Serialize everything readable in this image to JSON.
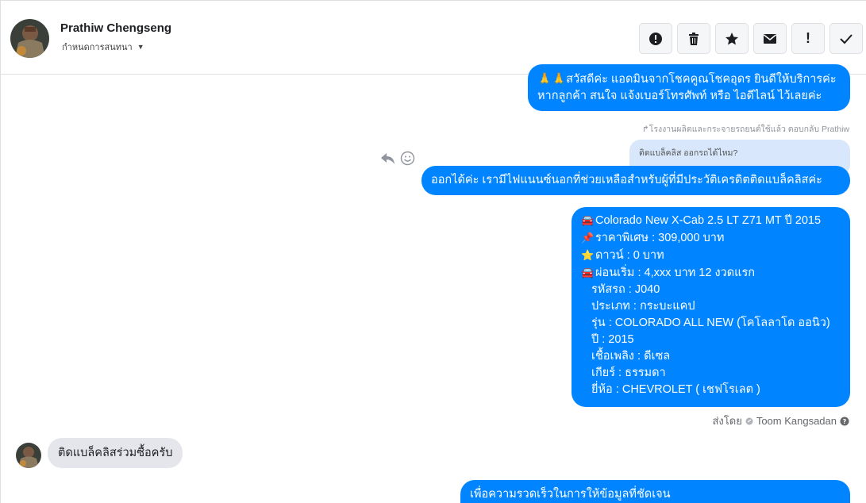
{
  "header": {
    "contact_name": "Prathiw Chengseng",
    "label_dropdown": "กำหนดการสนทนา",
    "toolbar": [
      {
        "icon": "alert-circle-icon"
      },
      {
        "icon": "trash-icon"
      },
      {
        "icon": "star-icon"
      },
      {
        "icon": "envelope-icon"
      },
      {
        "icon": "exclamation-icon",
        "text": "!"
      },
      {
        "icon": "check-icon"
      }
    ]
  },
  "messages": {
    "m1": {
      "line1": "🙏🙏สวัสดีค่ะ แอดมินจากโชคคูณโชคอุดร ยินดีให้บริการค่ะ",
      "line2": "หากลูกค้า สนใจ แจ้งเบอร์โทรศัพท์ หรือ ไอดีไลน์  ไว้เลยค่ะ"
    },
    "reply_note": "↱โรงงานผลิตและกระจายรถยนต์ใช้แล้ว ตอบกลับ Prathiw",
    "quoted": "ติดแบล็คลิส ออกรถได้ไหม?",
    "m2": "ออกได้ค่ะ เรามีไฟแนนซ์นอกที่ช่วยเหลือสำหรับผู้ที่มีประวัติเครดิตติดแบล็คลิสค่ะ",
    "m3": {
      "lines": [
        {
          "emoji": "🚘",
          "text": "Colorado New X-Cab 2.5 LT Z71 MT ปี 2015"
        },
        {
          "emoji": "📌",
          "text": "ราคาพิเศษ : 309,000 บาท"
        },
        {
          "emoji": "⭐",
          "text": "ดาวน์ : 0 บาท"
        },
        {
          "emoji": "🚘",
          "text": "ผ่อนเริ่ม : 4,xxx บาท 12 งวดแรก"
        }
      ],
      "details": [
        "รหัสรถ : J040",
        "ประเภท : กระบะแคป",
        "รุ่น : COLORADO ALL NEW (โคโลลาโด ออนิว)",
        "ปี : 2015",
        "เชื้อเพลิง : ดีเซล",
        "เกียร์ : ธรรมดา",
        "ยี่ห้อ : CHEVROLET ( เชฟโรเลต )"
      ]
    },
    "sender_prefix": "ส่งโดย",
    "sender_name": "Toom Kangsadan",
    "incoming": "ติดแบล็คลิสร่วมซื้อครับ",
    "m4": "เพื่อความรวดเร็วในการให้ข้อมูลที่ชัดเจน"
  },
  "colors": {
    "outgoing_bubble": "#0084ff",
    "incoming_bubble": "#e4e6eb",
    "quoted_bubble": "#d8e7fb"
  }
}
